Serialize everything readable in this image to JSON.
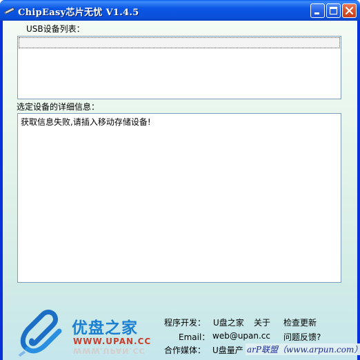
{
  "window": {
    "title": "ChipEasy芯片无忧 V1.4.5"
  },
  "usb_list": {
    "label": "USB设备列表："
  },
  "detail": {
    "label": "选定设备的详细信息：",
    "text": "获取信息失败,请插入移动存储设备!"
  },
  "logo": {
    "name": "优盘之家",
    "domain": "WWW.UPAN.CC"
  },
  "info": {
    "developer_label": "程序开发：",
    "developer_value": "U盘之家",
    "about": "关于",
    "check_update": "检查更新",
    "email_label": "Email：",
    "email_value": "web@upan.cc",
    "feedback": "问题反馈?",
    "media_label": "合作媒体：",
    "media_value": "U盘量产",
    "watermark": "arP联盟（www.arpun.com）"
  },
  "colors": {
    "titlebar": "#0a4fd8",
    "logo_blue": "#1c7fd1",
    "logo_red": "#c93e2c"
  }
}
